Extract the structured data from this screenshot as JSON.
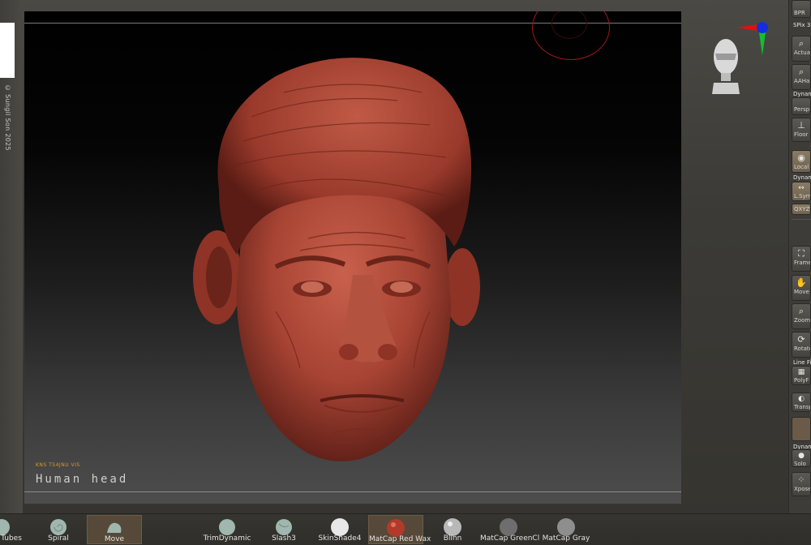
{
  "watermark": {
    "copyright": "© Sungil Son 2025"
  },
  "viewport": {
    "model_subtitle": "KNS TS4JNU VIS",
    "model_title": "Human head"
  },
  "right_toolbar": {
    "items": [
      {
        "label": "BPR",
        "icon": "render-icon"
      },
      {
        "label": "SPix 3",
        "icon": "spix-slider"
      },
      {
        "label": "Actual",
        "icon": "zoom-actual-icon"
      },
      {
        "label": "AAHalf",
        "icon": "zoom-half-icon"
      },
      {
        "label": "Dynamic",
        "icon": "text-label"
      },
      {
        "label": "Persp",
        "icon": "perspective-icon"
      },
      {
        "label": "Floor",
        "icon": "floor-icon"
      },
      {
        "label": "Local",
        "icon": "local-icon"
      },
      {
        "label": "Dynamic",
        "icon": "text-label"
      },
      {
        "label": "L.Sym",
        "icon": "symmetry-icon"
      },
      {
        "label": "QXYZ",
        "icon": "xyz-icon"
      },
      {
        "label": "Frame",
        "icon": "frame-icon"
      },
      {
        "label": "Move",
        "icon": "hand-icon"
      },
      {
        "label": "Zoom3D",
        "icon": "zoom3d-icon"
      },
      {
        "label": "Rotate",
        "icon": "rotate-icon"
      },
      {
        "label": "Line Fill",
        "icon": "text-label"
      },
      {
        "label": "PolyF",
        "icon": "polyframe-icon"
      },
      {
        "label": "Transp",
        "icon": "transparency-icon"
      },
      {
        "label": "Dynamic",
        "icon": "text-label"
      },
      {
        "label": "Solo",
        "icon": "solo-icon"
      },
      {
        "label": "Xpose",
        "icon": "xpose-icon"
      }
    ]
  },
  "bottom_shelf": {
    "items": [
      {
        "label": "Tubes",
        "kind": "brush",
        "color": "#9fb7ae"
      },
      {
        "label": "Spiral",
        "kind": "brush",
        "color": "#9fb7ae"
      },
      {
        "label": "Move",
        "kind": "brush",
        "color": "#9fb7ae",
        "selected": true
      },
      {
        "label": "TrimDynamic",
        "kind": "brush",
        "color": "#9fb7ae"
      },
      {
        "label": "Slash3",
        "kind": "brush",
        "color": "#9fb7ae"
      },
      {
        "label": "SkinShade4",
        "kind": "material",
        "color": "#e8e8e8"
      },
      {
        "label": "MatCap Red Wax",
        "kind": "material",
        "color": "#b23a2a",
        "selected": true
      },
      {
        "label": "Blinn",
        "kind": "material",
        "color": "#b8b8b8"
      },
      {
        "label": "MatCap GreenCl",
        "kind": "material",
        "color": "#6e6e6e"
      },
      {
        "label": "MatCap Gray",
        "kind": "material",
        "color": "#8e8e8e"
      }
    ]
  },
  "colors": {
    "accent_selected": "#56493a",
    "model_clay": "#b04a3a",
    "gizmo_x": "#e01010",
    "gizmo_y": "#10c030",
    "gizmo_z": "#1030e0"
  }
}
